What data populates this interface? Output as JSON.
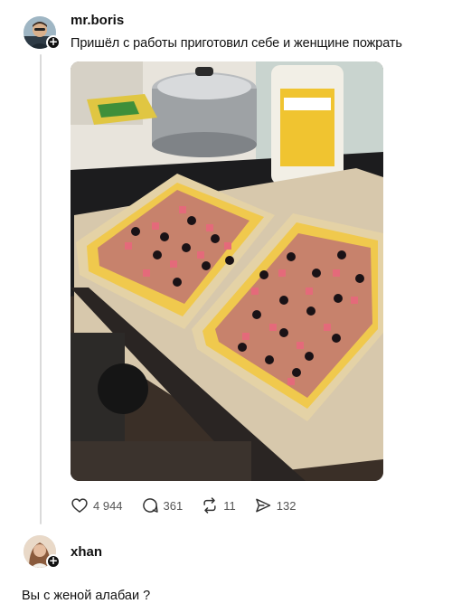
{
  "post": {
    "username": "mr.boris",
    "text": "Пришёл с работы приготовил себе и женщине пожрать",
    "image_icon": "pizza-tray-photo",
    "stats": {
      "likes": "4 944",
      "comments": "361",
      "reposts": "11",
      "shares": "132"
    }
  },
  "reply": {
    "username": "xhan",
    "text": "Вы с женой алабаи ?"
  },
  "icons": {
    "like": "heart-icon",
    "comment": "comment-bubble-icon",
    "repost": "repost-arrows-icon",
    "share": "send-arrow-icon",
    "follow": "plus-icon"
  },
  "colors": {
    "text": "#111111",
    "muted": "#555555",
    "thread_line": "#dadada"
  }
}
